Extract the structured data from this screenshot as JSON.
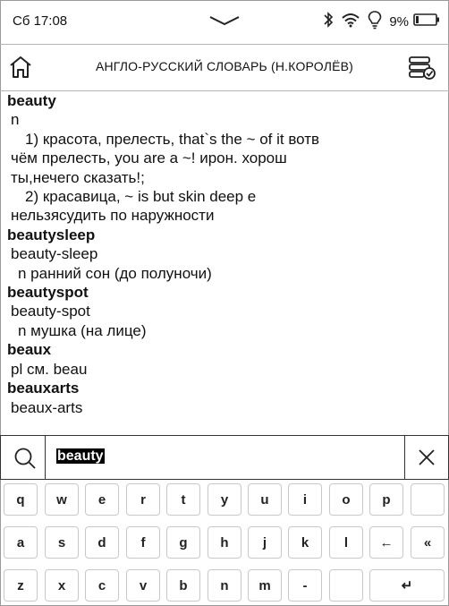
{
  "status": {
    "time": "Сб 17:08",
    "battery": "9%"
  },
  "header": {
    "title": "АНГЛО-РУССКИЙ СЛОВАРЬ (Н.КОРОЛЁВ)"
  },
  "entries": [
    {
      "head": "beauty",
      "lines": [
        {
          "text": "n",
          "indent": 1
        },
        {
          "text": "1) красота, прелесть, that`s the ~ of it вотв",
          "indent": 3
        },
        {
          "text": "чём прелесть, you are a ~! ирон. хорош",
          "indent": 1
        },
        {
          "text": "ты,нечего сказать!;",
          "indent": 1
        },
        {
          "text": "2) красавица, ~ is but skin deep е",
          "indent": 3
        },
        {
          "text": "нельзясудить по наружности",
          "indent": 1
        }
      ]
    },
    {
      "head": "beautysleep",
      "lines": [
        {
          "text": "beauty-sleep",
          "indent": 1
        },
        {
          "text": "n ранний сон (до полуночи)",
          "indent": 2
        }
      ]
    },
    {
      "head": "beautyspot",
      "lines": [
        {
          "text": "beauty-spot",
          "indent": 1
        },
        {
          "text": "n мушка (на лице)",
          "indent": 2
        }
      ]
    },
    {
      "head": "beaux",
      "lines": [
        {
          "text": "pl см. beau",
          "indent": 1
        }
      ]
    },
    {
      "head": "beauxarts",
      "lines": [
        {
          "text": "beaux-arts",
          "indent": 1
        }
      ]
    }
  ],
  "search": {
    "value": "beauty"
  },
  "keyboard": {
    "rows": [
      [
        "q",
        "w",
        "e",
        "r",
        "t",
        "y",
        "u",
        "i",
        "o",
        "p",
        ""
      ],
      [
        "a",
        "s",
        "d",
        "f",
        "g",
        "h",
        "j",
        "k",
        "l",
        "←",
        "«"
      ],
      [
        "z",
        "x",
        "c",
        "v",
        "b",
        "n",
        "m",
        "-",
        "",
        "",
        "↵"
      ]
    ]
  }
}
